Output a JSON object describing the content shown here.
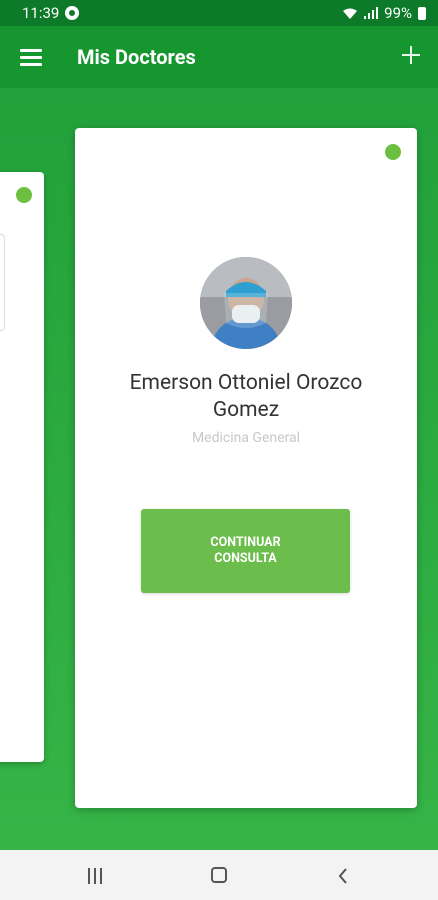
{
  "status_bar": {
    "time": "11:39",
    "battery": "99%"
  },
  "app_bar": {
    "title": "Mis Doctores"
  },
  "card": {
    "doctor_name": "Emerson Ottoniel Orozco Gomez",
    "specialty": "Medicina General",
    "button_label": "CONTINUAR CONSULTA",
    "status_color": "#6cbf3f"
  },
  "colors": {
    "status_bar": "#0c7a28",
    "app_bar": "#15962f",
    "background": "#2aa63a",
    "button": "#6bbd4c"
  },
  "icons": [
    "notification-icon",
    "wifi-icon",
    "signal-icon",
    "battery-icon",
    "menu-icon",
    "add-icon",
    "recent-apps-icon",
    "home-icon",
    "back-icon"
  ]
}
